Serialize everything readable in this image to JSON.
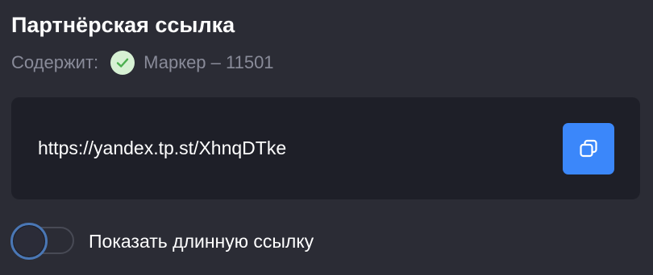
{
  "title": "Партнёрская ссылка",
  "contains": {
    "label": "Содержит:",
    "value": "Маркер – 11501",
    "icon": "check-circle-icon",
    "icon_color": "#4caf50"
  },
  "link": {
    "url": "https://yandex.tp.st/XhnqDTke",
    "copy_icon": "copy-icon",
    "copy_button_color": "#3b87fa"
  },
  "toggle": {
    "label": "Показать длинную ссылку",
    "checked": false
  }
}
